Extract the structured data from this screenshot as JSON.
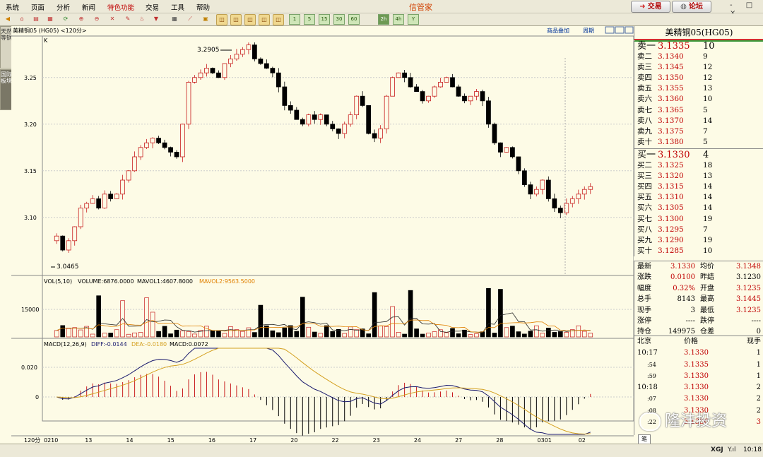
{
  "app": {
    "title": "信管家"
  },
  "menu": [
    "系统",
    "页面",
    "分析",
    "新闻",
    "特色功能",
    "交易",
    "工具",
    "帮助"
  ],
  "menu_highlight": "特色功能",
  "top_buttons": {
    "trade": "交易",
    "forum": "论坛"
  },
  "window_controls": "- □ ×",
  "toolbar": {
    "periods": [
      "1",
      "5",
      "15",
      "30",
      "60",
      "2h",
      "4h",
      "Y"
    ],
    "active_period": "2h"
  },
  "left_tabs": [
    "天然等锅",
    "国际板块"
  ],
  "chart_header": {
    "symbol": "美精铜05 (HG05) <120分>",
    "overlay_label": "商品叠加",
    "period_label": "周期",
    "k_label": "K"
  },
  "price_axis": [
    "3.25",
    "3.20",
    "3.15",
    "3.10"
  ],
  "annotations": {
    "high": "3.2905",
    "low": "3.0465"
  },
  "vol_header": {
    "label": "VOL(5,10)",
    "volume": "VOLUME:6876.0000",
    "mavol1": "MAVOL1:4607.8000",
    "mavol2": "MAVOL2:9563.5000",
    "axis": "15000"
  },
  "macd_header": {
    "label": "MACD(12,26,9)",
    "diff": "DIFF:-0.0144",
    "dea": "DEA:-0.0180",
    "macd": "MACD:0.0072",
    "axis_top": "0.020",
    "axis_zero": "0"
  },
  "date_axis": [
    "0210",
    "13",
    "14",
    "15",
    "16",
    "17",
    "20",
    "22",
    "23",
    "24",
    "27",
    "28",
    "0301",
    "02"
  ],
  "date_axis_unit": "120分",
  "quote": {
    "title": "美精铜05(HG05)",
    "asks": [
      {
        "label": "卖十",
        "price": "3.1380",
        "vol": "5"
      },
      {
        "label": "卖九",
        "price": "3.1375",
        "vol": "7"
      },
      {
        "label": "卖八",
        "price": "3.1370",
        "vol": "14"
      },
      {
        "label": "卖七",
        "price": "3.1365",
        "vol": "5"
      },
      {
        "label": "卖六",
        "price": "3.1360",
        "vol": "10"
      },
      {
        "label": "卖五",
        "price": "3.1355",
        "vol": "13"
      },
      {
        "label": "卖四",
        "price": "3.1350",
        "vol": "12"
      },
      {
        "label": "卖三",
        "price": "3.1345",
        "vol": "12"
      },
      {
        "label": "卖二",
        "price": "3.1340",
        "vol": "9"
      },
      {
        "label": "卖一",
        "price": "3.1335",
        "vol": "10"
      }
    ],
    "bids": [
      {
        "label": "买一",
        "price": "3.1330",
        "vol": "4"
      },
      {
        "label": "买二",
        "price": "3.1325",
        "vol": "18"
      },
      {
        "label": "买三",
        "price": "3.1320",
        "vol": "13"
      },
      {
        "label": "买四",
        "price": "3.1315",
        "vol": "14"
      },
      {
        "label": "买五",
        "price": "3.1310",
        "vol": "14"
      },
      {
        "label": "买六",
        "price": "3.1305",
        "vol": "14"
      },
      {
        "label": "买七",
        "price": "3.1300",
        "vol": "19"
      },
      {
        "label": "买八",
        "price": "3.1295",
        "vol": "7"
      },
      {
        "label": "买九",
        "price": "3.1290",
        "vol": "19"
      },
      {
        "label": "买十",
        "price": "3.1285",
        "vol": "10"
      }
    ],
    "stats": [
      {
        "k1": "最新",
        "v1": "3.1330",
        "k2": "均价",
        "v2": "3.1348"
      },
      {
        "k1": "涨跌",
        "v1": "0.0100",
        "k2": "昨结",
        "v2": "3.1230"
      },
      {
        "k1": "幅度",
        "v1": "0.32%",
        "k2": "开盘",
        "v2": "3.1235"
      },
      {
        "k1": "总手",
        "v1": "8143",
        "k2": "最高",
        "v2": "3.1445"
      },
      {
        "k1": "现手",
        "v1": "3",
        "k2": "最低",
        "v2": "3.1235"
      },
      {
        "k1": "涨停",
        "v1": "----",
        "k2": "跌停",
        "v2": "----"
      },
      {
        "k1": "持仓",
        "v1": "149975",
        "k2": "仓差",
        "v2": "0"
      }
    ],
    "ticks_header": {
      "time": "北京",
      "price": "价格",
      "vol": "现手"
    },
    "ticks": [
      {
        "time": "10:17",
        "price": "3.1330",
        "vol": "1"
      },
      {
        "time": ":54",
        "price": "3.1335",
        "vol": "1"
      },
      {
        "time": ":59",
        "price": "3.1330",
        "vol": "1"
      },
      {
        "time": "10:18",
        "price": "3.1330",
        "vol": "2"
      },
      {
        "time": ":07",
        "price": "3.1330",
        "vol": "2"
      },
      {
        "time": ":08",
        "price": "3.1330",
        "vol": "2"
      },
      {
        "time": ":22",
        "price": "3.1330",
        "vol": "3"
      }
    ],
    "bottom_tab": "笔"
  },
  "watermark": "隆沣投资",
  "status": {
    "brand": "XGJ",
    "time": "10:18"
  },
  "colors": {
    "up": "#c81e1e",
    "down": "#000000",
    "bg": "#fdfbe6",
    "diff": "#1a1a6e",
    "dea": "#d4a020",
    "mavol1": "#222222",
    "mavol2": "#e08000"
  },
  "chart_data": {
    "type": "candlestick",
    "x_labels": [
      "0210",
      "13",
      "14",
      "15",
      "16",
      "17",
      "20",
      "22",
      "23",
      "24",
      "27",
      "28",
      "0301",
      "02"
    ],
    "ylim": [
      3.04,
      3.29
    ],
    "y_ticks": [
      3.1,
      3.15,
      3.2,
      3.25
    ],
    "annotated_high": 3.2905,
    "annotated_low": 3.0465,
    "last": 3.133,
    "volume_axis_tick": 15000,
    "macd_axis_ticks": [
      0.02,
      0
    ],
    "ohlc_profile": [
      3.08,
      3.065,
      3.075,
      3.09,
      3.11,
      3.115,
      3.12,
      3.11,
      3.125,
      3.12,
      3.125,
      3.14,
      3.15,
      3.165,
      3.175,
      3.18,
      3.185,
      3.18,
      3.175,
      3.17,
      3.165,
      3.2,
      3.245,
      3.25,
      3.255,
      3.26,
      3.255,
      3.25,
      3.265,
      3.27,
      3.275,
      3.28,
      3.285,
      3.27,
      3.265,
      3.26,
      3.255,
      3.24,
      3.22,
      3.215,
      3.205,
      3.2,
      3.21,
      3.205,
      3.21,
      3.2,
      3.195,
      3.19,
      3.2,
      3.21,
      3.23,
      3.22,
      3.19,
      3.185,
      3.195,
      3.23,
      3.25,
      3.255,
      3.25,
      3.24,
      3.235,
      3.225,
      3.23,
      3.24,
      3.245,
      3.25,
      3.24,
      3.23,
      3.225,
      3.23,
      3.235,
      3.225,
      3.2,
      3.18,
      3.17,
      3.175,
      3.165,
      3.15,
      3.135,
      3.125,
      3.13,
      3.14,
      3.12,
      3.11,
      3.105,
      3.115,
      3.12,
      3.125,
      3.13,
      3.133
    ]
  }
}
